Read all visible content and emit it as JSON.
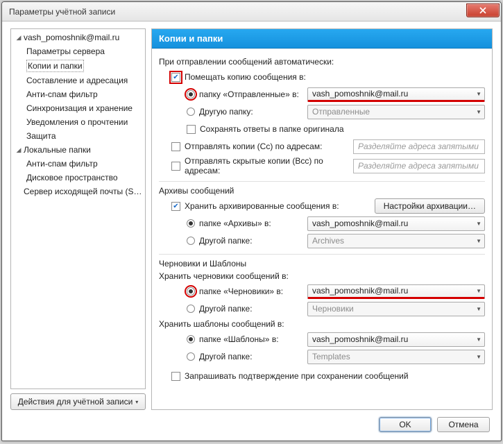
{
  "window": {
    "title": "Параметры учётной записи"
  },
  "sidebar": {
    "account": "vash_pomoshnik@mail.ru",
    "items": [
      "Параметры сервера",
      "Копии и папки",
      "Составление и адресация",
      "Анти-спам фильтр",
      "Синхронизация и хранение",
      "Уведомления о прочтении",
      "Защита"
    ],
    "local_header": "Локальные папки",
    "local_items": [
      "Анти-спам фильтр",
      "Дисковое пространство"
    ],
    "smtp": "Сервер исходящей почты (S…",
    "account_actions": "Действия для учётной записи"
  },
  "panel": {
    "title": "Копии и папки",
    "auto_label": "При отправлении сообщений автоматически:",
    "place_copy": "Помещать копию сообщения в:",
    "sent_folder_label": "папку «Отправленные» в:",
    "sent_account": "vash_pomoshnik@mail.ru",
    "other_folder_label": "Другую папку:",
    "other_sent_value": "Отправленные",
    "save_replies": "Сохранять ответы в папке оригинала",
    "cc_label": "Отправлять копии (Cc) по адресам:",
    "bcc_label": "Отправлять скрытые копии (Bcc) по адресам:",
    "addr_placeholder": "Разделяйте адреса запятыми",
    "archives_header": "Архивы сообщений",
    "keep_archived": "Хранить архивированные сообщения в:",
    "archive_settings_btn": "Настройки архивации…",
    "archives_folder_label": "папке «Архивы» в:",
    "archives_account": "vash_pomoshnik@mail.ru",
    "archives_other_value": "Archives",
    "drafts_header": "Черновики и Шаблоны",
    "keep_drafts": "Хранить черновики сообщений в:",
    "drafts_folder_label": "папке «Черновики» в:",
    "drafts_account": "vash_pomoshnik@mail.ru",
    "drafts_other_value": "Черновики",
    "keep_templates": "Хранить шаблоны сообщений в:",
    "templates_folder_label": "папке «Шаблоны» в:",
    "templates_account": "vash_pomoshnik@mail.ru",
    "templates_other_value": "Templates",
    "other_folder_label2": "Другой папке:",
    "confirm_save": "Запрашивать подтверждение при сохранении сообщений"
  },
  "buttons": {
    "ok": "OK",
    "cancel": "Отмена"
  }
}
